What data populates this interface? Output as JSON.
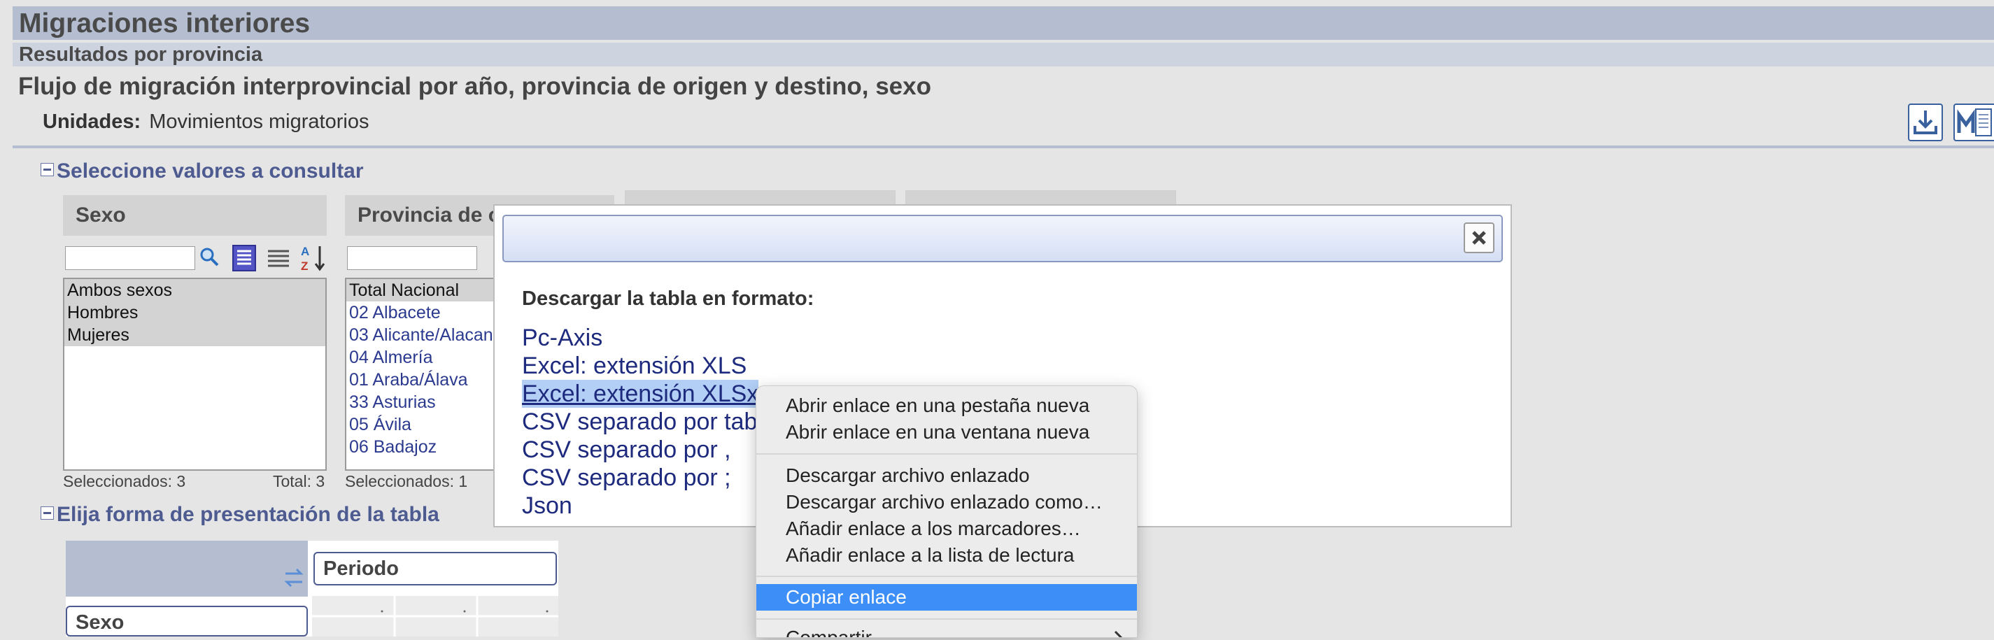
{
  "header": {
    "title": "Migraciones interiores",
    "subtitle": "Resultados por provincia",
    "table_title": "Flujo de migración interprovincial por año, provincia de origen y destino, sexo",
    "units_label": "Unidades:",
    "units_value": "Movimientos migratorios"
  },
  "toolbar": {
    "download_icon": "download-icon",
    "metadata_icon": "metadata-icon"
  },
  "selection_section": {
    "title": "Seleccione valores a consultar",
    "panels": [
      {
        "title": "Sexo",
        "options": [
          "Ambos sexos",
          "Hombres",
          "Mujeres"
        ],
        "selected_label": "Seleccionados: 3",
        "total_label": "Total: 3"
      },
      {
        "title": "Provincia de o",
        "options": [
          "Total Nacional",
          "02 Albacete",
          "03 Alicante/Alacan",
          "04 Almería",
          "01 Araba/Álava",
          "33 Asturias",
          "05 Ávila",
          "06 Badajoz"
        ],
        "selected_label": "Seleccionados: 1"
      }
    ]
  },
  "presentation_section": {
    "title": "Elija forma de presentación de la tabla",
    "column_field": "Periodo",
    "row_field": "Sexo"
  },
  "modal": {
    "heading": "Descargar la tabla en formato:",
    "formats": [
      "Pc-Axis",
      "Excel: extensión XLS",
      "Excel: extensión XLSx",
      "CSV separado por tab",
      "CSV separado por ,",
      "CSV separado por ;",
      "Json"
    ],
    "close_icon": "close-icon"
  },
  "context_menu": {
    "groups": [
      [
        "Abrir enlace en una pestaña nueva",
        "Abrir enlace en una ventana nueva"
      ],
      [
        "Descargar archivo enlazado",
        "Descargar archivo enlazado como…",
        "Añadir enlace a los marcadores…",
        "Añadir enlace a la lista de lectura"
      ],
      [
        "Copiar enlace"
      ],
      [
        "Compartir"
      ]
    ]
  },
  "colors": {
    "header_bar": "#b5bed1",
    "link": "#1d2a7d",
    "menu_highlight": "#3d8ff7",
    "section_title": "#4d5b91"
  }
}
